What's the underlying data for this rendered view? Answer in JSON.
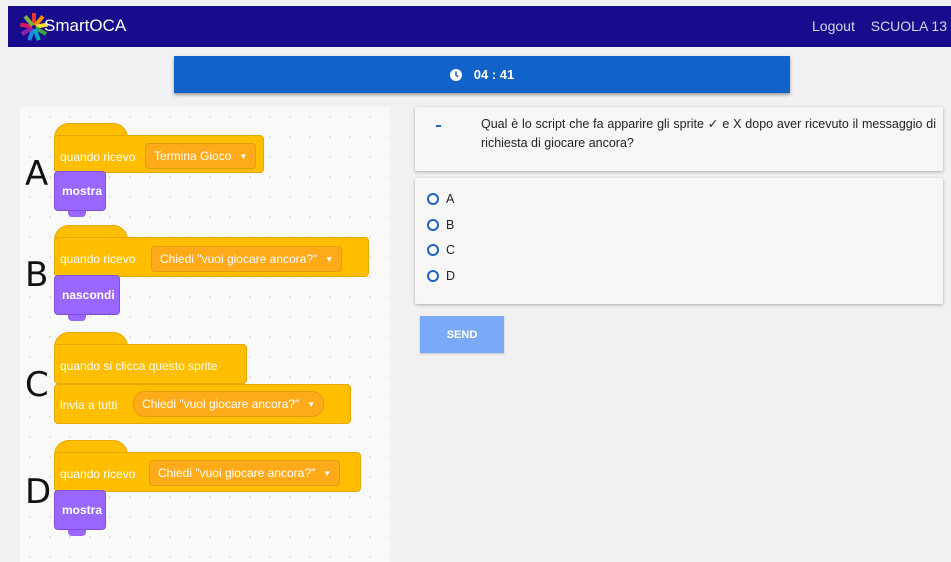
{
  "navbar": {
    "brand": "SmartOCA",
    "logout": "Logout",
    "school": "SCUOLA 13"
  },
  "timer": {
    "icon": "clock-icon",
    "value": "04 : 41"
  },
  "question": {
    "marker": "-",
    "text": "Qual è lo script che fa apparire gli sprite ✓ e X dopo aver ricevuto il messaggio di richiesta di giocare ancora?"
  },
  "options": [
    "A",
    "B",
    "C",
    "D"
  ],
  "send_label": "SEND",
  "blocks": {
    "a": {
      "letter": "A",
      "event": "quando ricevo",
      "dropdown": "Termina Gioco",
      "action": "mostra"
    },
    "b": {
      "letter": "B",
      "event": "quando ricevo",
      "dropdown": "Chiedi \"vuoi giocare ancora?\"",
      "action": "nascondi"
    },
    "c": {
      "letter": "C",
      "event": "quando si clicca questo sprite",
      "action": "invia a tutti",
      "dropdown": "Chiedi \"vuoi giocare ancora?\""
    },
    "d": {
      "letter": "D",
      "event": "quando ricevo",
      "dropdown": "Chiedi \"vuoi giocare ancora?\"",
      "action": "mostra"
    }
  },
  "colors": {
    "navbar": "#170c8c",
    "timer": "#1163c9",
    "events_block": "#ffbf00",
    "looks_block": "#9966ff",
    "send_button": "#7aaaf7",
    "radio": "#1e62c4"
  }
}
